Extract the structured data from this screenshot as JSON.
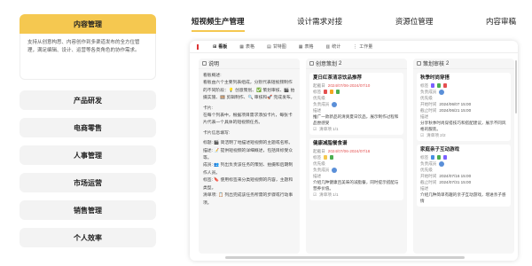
{
  "sidebar": {
    "active": {
      "label": "内容管理",
      "desc": "支持从创意构思、内容创作到多渠道发布的全方位管理，满足编辑、设计、运营等各类角色的协作需求。"
    },
    "items": [
      "产品研发",
      "电商零售",
      "人事管理",
      "市场运营",
      "销售管理",
      "个人效率"
    ]
  },
  "tabs": [
    "短视频生产管理",
    "设计需求对接",
    "资源位管理",
    "内容审稿"
  ],
  "toolbar": [
    "看板",
    "表格",
    "甘特图",
    "表格",
    "统计",
    "工作量"
  ],
  "columns": {
    "c1": {
      "title": "说明"
    },
    "c2": {
      "title": "创意策划",
      "count": "2"
    },
    "c3": {
      "title": "策划审核",
      "count": "2"
    }
  },
  "notes": {
    "l1": "看板概述:",
    "l2": "看板由六个主要列表组成，分别代表短视频制作的不同阶段：💡 创意策划、✅ 策划审核、🎬 拍摄实施、🎞️ 剪辑制作、🔍 审核和🚀 完成发布。",
    "l3": "卡片:",
    "l4": "在每个列表中，根据项目需求添加卡片，每张卡片代表一个具体的短视频任务。",
    "l5": "卡片信息填写:",
    "l6": "标题: 🎬 简洁明了地描述短视频的主题或名称。",
    "l7": "描述: 📝 提供短视频的详细概述，包括目标受众等。",
    "l8": "成员: 👥 列出负责该任务的策划、拍摄和后期制作人员。",
    "l9": "标签: 🔖 使用标签来分类短视频的内容，主题和类型。",
    "l10": "清单项: 📋 列出完成该任务所需的步骤或行动事项。"
  },
  "cards": {
    "a": {
      "title": "夏日红茶清凉饮品推荐",
      "date_label": "起截日",
      "date": "2024/07/06-2024/07/10",
      "tags_label": "标签",
      "priority_label": "优先级",
      "members_label": "负责成员",
      "desc_label": "描述",
      "desc": "推广一款新品的清爽夏日饮品，展示制作过程和品尝感受",
      "check": "清单项 1/1"
    },
    "b": {
      "title": "健康减脂餐食谱",
      "date_label": "起截日",
      "date": "2024/07/06-2024/07/16",
      "tags_label": "标签",
      "priority_label": "优先级",
      "members_label": "负责成员",
      "desc_label": "描述",
      "desc": "介绍几种健康且美味的减脂餐，同时提示搭配与营养价值。",
      "check": "清单项 1/1"
    },
    "c": {
      "title": "秋季时尚穿搭",
      "tags_label": "标签",
      "members_label": "负责成员",
      "priority_label": "优先级",
      "start_label": "开始时间",
      "start": "2024/06/07 15:00",
      "end_label": "截止时间",
      "end": "2024/06/21 15:00",
      "desc_label": "描述",
      "desc": "分享秋季时尚穿搭技巧和搭配建议，展示不同风格的服装。",
      "check": "清单项 2/2"
    },
    "d": {
      "title": "家庭亲子互动游戏",
      "tags_label": "标签",
      "members_label": "负责成员",
      "priority_label": "优先级",
      "start_label": "开始时间",
      "start": "2024/07/16 15:00",
      "end_label": "截止时间",
      "end": "2024/07/31 15:00",
      "desc_label": "描述",
      "desc": "介绍几种简单有趣的亲子互动游戏，增进亲子感情"
    }
  },
  "colors": {
    "accent": "#f5c850",
    "red": "#e45050"
  }
}
